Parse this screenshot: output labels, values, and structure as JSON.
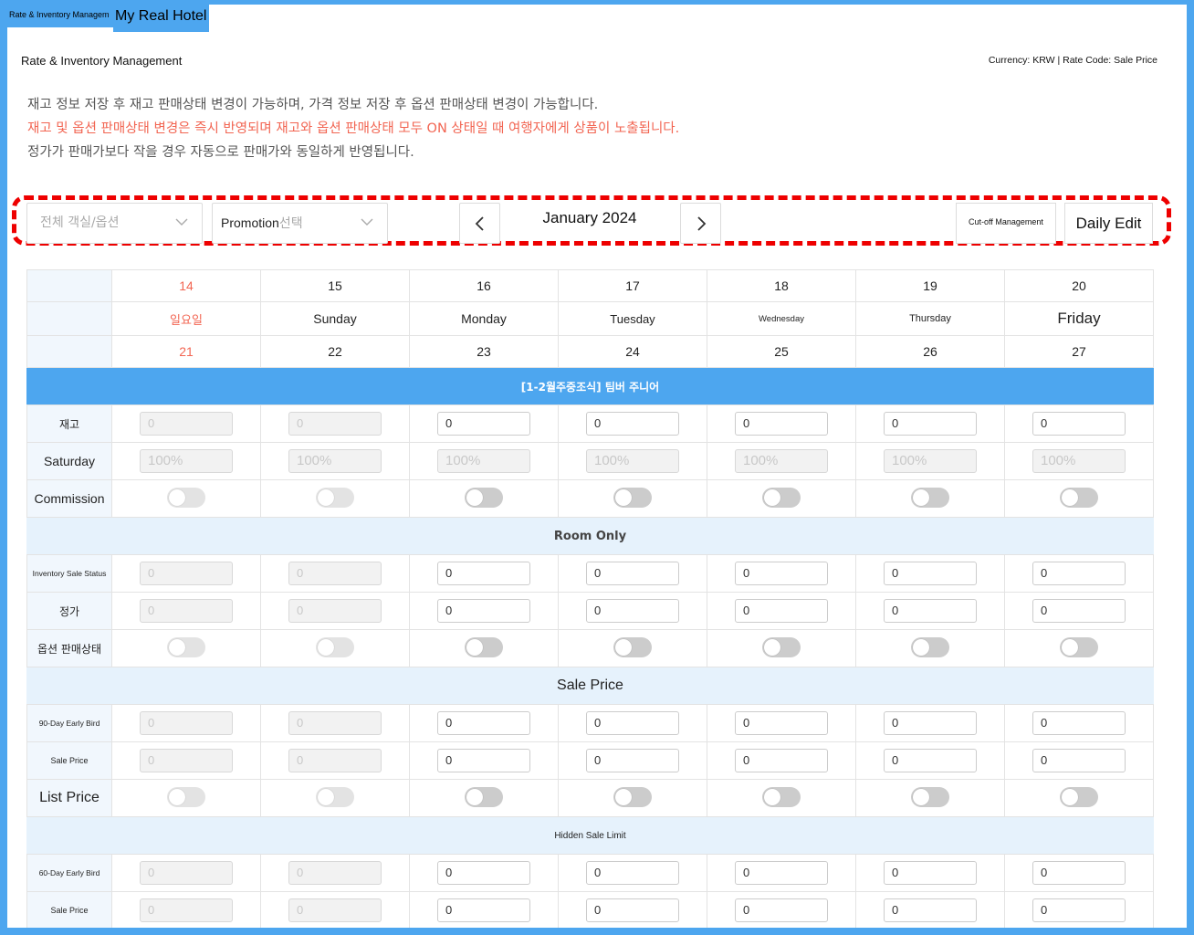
{
  "header": {
    "tab_small": "Rate & Inventory Managem",
    "tab_hotel": "My Real Hotel",
    "title": "Rate & Inventory Management",
    "currency": "Currency: KRW | Rate Code: Sale Price"
  },
  "notices": [
    "재고 정보 저장 후 재고 판매상태 변경이 가능하며, 가격 정보 저장 후 옵션 판매상태 변경이 가능합니다.",
    "재고 및 옵션 판매상태 변경은 즉시 반영되며 재고와 옵션 판매상태 모두 ON 상태일 때 여행자에게 상품이 노출됩니다.",
    "정가가 판매가보다 작을 경우 자동으로 판매가와 동일하게 반영됩니다."
  ],
  "toolbar": {
    "room_select_placeholder": "전체 객실/옵션",
    "promotion_label": "Promotion",
    "promotion_placeholder": "선택",
    "month": "January 2024",
    "cutoff_label": "Cut-off Management",
    "daily_edit_label": "Daily Edit",
    "accent_color": "#ee0000"
  },
  "calendar": {
    "top_dates": [
      "14",
      "15",
      "16",
      "17",
      "18",
      "19",
      "20"
    ],
    "weekdays": [
      "일요일",
      "Sunday",
      "Monday",
      "Tuesday",
      "Wednesday",
      "Thursday",
      "Friday"
    ],
    "bottom_dates": [
      "21",
      "22",
      "23",
      "24",
      "25",
      "26",
      "27"
    ],
    "selected_index": 2
  },
  "sections": [
    {
      "title": "[1-2월주중조식] 팀버 주니어",
      "rows": [
        {
          "label": "재고",
          "type": "input",
          "value": "0"
        },
        {
          "label": "Saturday",
          "type": "input",
          "value": "100%",
          "all_disabled": true
        },
        {
          "label": "Commission",
          "type": "toggle"
        }
      ]
    },
    {
      "title": "Room Only",
      "rows": [
        {
          "label": "Inventory Sale Status",
          "type": "input",
          "value": "0"
        },
        {
          "label": "정가",
          "type": "input",
          "value": "0"
        },
        {
          "label": "옵션 판매상태",
          "type": "toggle"
        }
      ]
    },
    {
      "title": "Sale Price",
      "rows": [
        {
          "label": "90-Day Early Bird",
          "type": "input",
          "value": "0"
        },
        {
          "label": "Sale Price",
          "type": "input",
          "value": "0"
        },
        {
          "label": "List Price",
          "type": "toggle"
        }
      ]
    },
    {
      "title": "Hidden Sale Limit",
      "rows": [
        {
          "label": "60-Day Early Bird",
          "type": "input",
          "value": "0"
        },
        {
          "label": "Sale Price",
          "type": "input",
          "value": "0"
        }
      ]
    }
  ],
  "colors": {
    "brand_blue": "#4da6ef",
    "sunday_red": "#f26552",
    "label_bg": "#f1f7fd"
  }
}
